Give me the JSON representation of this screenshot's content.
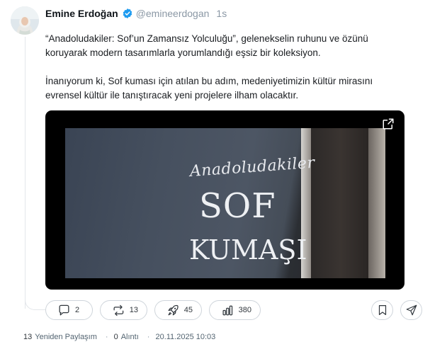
{
  "author": {
    "name": "Emine Erdoğan",
    "handle": "@emineerdogan",
    "time": "1s",
    "verified": true,
    "avatar_icon": "profile-photo"
  },
  "post": {
    "paragraph1": "“Anadoludakiler: Sof’un Zamansız Yolculuğu”, geleneksel­in ruhunu ve özünü koruyarak modern tasarımlarla yorumlandığı eşsiz bir koleksiyon.",
    "paragraph2": "İnanıyorum ki, Sof kuması için atılan bu adım, medeniyetimizin kültür mirasını evrensel kültür ile tanıştıracak yeni projelere ilham olacaktır."
  },
  "media": {
    "title_script": "Anadoludakiler",
    "title_main": "SOF",
    "title_sub": "KUMAŞI",
    "expand_icon": "external-link-icon"
  },
  "actions": {
    "reply_count": "2",
    "repost_count": "13",
    "like_count": "45",
    "views_count": "380",
    "bookmark_icon": "bookmark-icon",
    "share_icon": "send-icon"
  },
  "footer": {
    "reposts_count": "13",
    "reposts_label": "Yeniden Paylaşım",
    "quotes_count": "0",
    "quotes_label": "Alıntı",
    "datetime": "20.11.2025 10:03"
  },
  "colors": {
    "verified_blue": "#1d9bf0",
    "border": "#cfd5db",
    "muted_text": "#8b98a5"
  }
}
